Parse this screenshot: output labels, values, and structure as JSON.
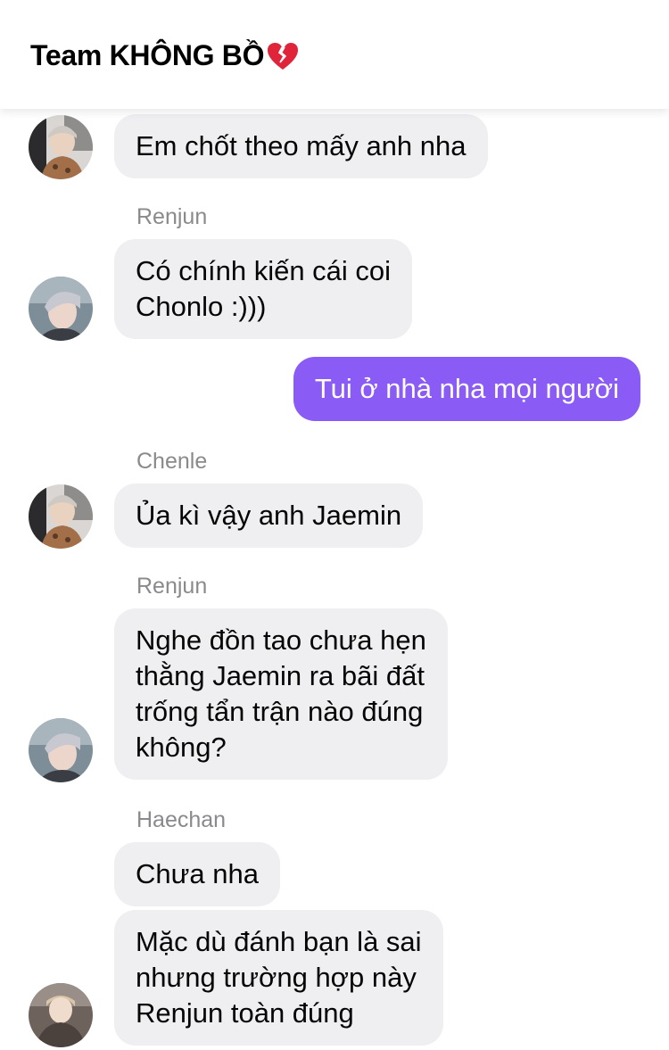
{
  "header": {
    "title": "Team KHÔNG BỒ",
    "title_icon": "broken-heart-icon",
    "icon_color": "#e0243a"
  },
  "colors": {
    "incoming_bubble": "#efeff2",
    "outgoing_bubble": "#8a5cf5",
    "sender_name": "#8a8a8e"
  },
  "messages": [
    {
      "text": "Em chốt theo mấy anh nha"
    },
    {
      "sender": "Renjun",
      "text_lines": [
        "Có chính kiến cái coi",
        "Chonlo :)))"
      ]
    },
    {
      "text": "Tui ở nhà nha mọi người"
    },
    {
      "sender": "Chenle",
      "text": "Ủa kì vậy anh Jaemin"
    },
    {
      "sender": "Renjun",
      "text_lines": [
        "Nghe đồn tao chưa hẹn",
        "thằng Jaemin ra bãi đất",
        "trống tẩn trận nào đúng",
        "không?"
      ]
    },
    {
      "sender": "Haechan",
      "text": "Chưa nha"
    },
    {
      "text_lines": [
        "Mặc dù đánh bạn là sai",
        "nhưng trường hợp này",
        "Renjun toàn đúng"
      ]
    }
  ]
}
